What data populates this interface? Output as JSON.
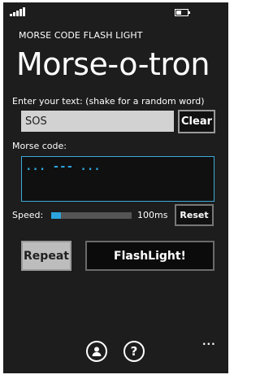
{
  "status_bar": {
    "signal_bars": 5,
    "battery_level": 0.45,
    "battery_icon": "battery-charging-icon",
    "signal_icon": "signal-strength-icon"
  },
  "app": {
    "subtitle": "MORSE CODE FLASH LIGHT",
    "title": "Morse-o-tron"
  },
  "input": {
    "label": "Enter your text: (shake for a random word)",
    "value": "SOS",
    "clear_label": "Clear"
  },
  "morse": {
    "label": "Morse code:",
    "output": "... --- ...",
    "accent_color": "#2ca4dd"
  },
  "speed": {
    "label": "Speed:",
    "fraction": 0.12,
    "value_text": "100ms",
    "reset_label": "Reset"
  },
  "actions": {
    "repeat_label": "Repeat",
    "flash_label": "FlashLight!"
  },
  "app_bar": {
    "icons": [
      "contact-icon",
      "help-icon"
    ],
    "more_label": "..."
  }
}
